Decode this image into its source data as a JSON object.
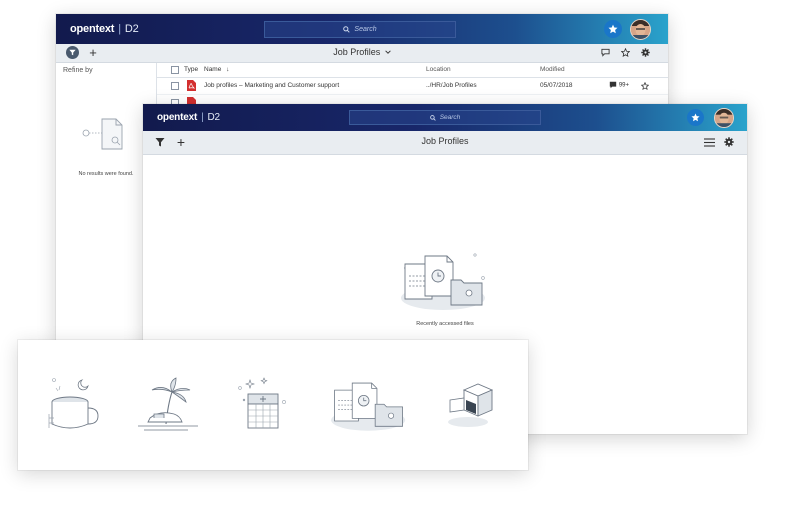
{
  "back_window": {
    "brand": "opentext",
    "product": "D2",
    "search_placeholder": "Search",
    "toolbar_title": "Job Profiles",
    "refine_label": "Refine by",
    "no_results": "No results were found.",
    "columns": {
      "type": "Type",
      "name": "Name",
      "location": "Location",
      "modified": "Modified"
    },
    "rows": [
      {
        "name": "Job profiles – Marketing and Customer support",
        "location": "../HR/Job Profiles",
        "modified": "05/07/2018",
        "comments": "99+"
      }
    ]
  },
  "front_window": {
    "brand": "opentext",
    "product": "D2",
    "search_placeholder": "Search",
    "toolbar_title": "Job Profiles",
    "empty_caption": "Recently accessed files"
  },
  "colors": {
    "accent": "#1a76c9",
    "header_dark": "#121a4d",
    "header_light": "#2aa3cc",
    "pdf_red": "#d32f2f"
  }
}
